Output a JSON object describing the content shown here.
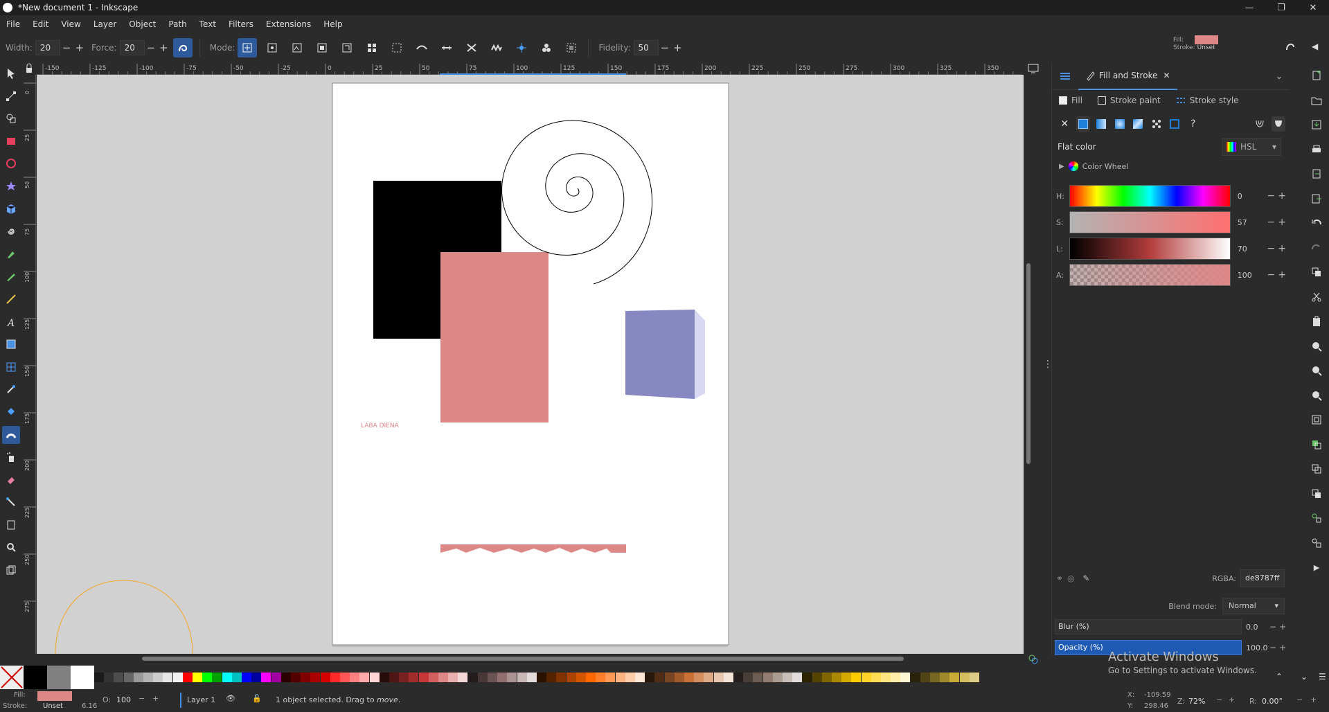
{
  "window": {
    "title": "*New document 1 - Inkscape",
    "controls": [
      "—",
      "❐",
      "✕"
    ]
  },
  "menu": [
    "File",
    "Edit",
    "View",
    "Layer",
    "Object",
    "Path",
    "Text",
    "Filters",
    "Extensions",
    "Help"
  ],
  "toolbar": {
    "width_label": "Width:",
    "width_value": "20",
    "force_label": "Force:",
    "force_value": "20",
    "mode_label": "Mode:",
    "fidelity_label": "Fidelity:",
    "fidelity_value": "50"
  },
  "fill_indicator": {
    "fill_label": "Fill:",
    "stroke_label": "Stroke:",
    "stroke_value": "Unset",
    "fill_color": "#de8787"
  },
  "ruler": {
    "top_labels": [
      "-150",
      "-125",
      "-100",
      "-75",
      "-50",
      "-25",
      "0",
      "25",
      "50",
      "75",
      "100",
      "125",
      "150",
      "175",
      "200",
      "225",
      "250",
      "275",
      "300",
      "325",
      "350"
    ],
    "left_labels": [
      "0",
      "25",
      "50",
      "75",
      "100",
      "125",
      "150",
      "175",
      "200",
      "225",
      "250",
      "275"
    ]
  },
  "canvas": {
    "text_object": "LABA DIENA"
  },
  "dialog": {
    "tab_label": "Fill and Stroke",
    "subtabs": [
      "Fill",
      "Stroke paint",
      "Stroke style"
    ],
    "flat_color_label": "Flat color",
    "color_mode": "HSL",
    "color_wheel_label": "Color Wheel",
    "sliders": [
      {
        "label": "H:",
        "value": "0"
      },
      {
        "label": "S:",
        "value": "57"
      },
      {
        "label": "L:",
        "value": "70"
      },
      {
        "label": "A:",
        "value": "100"
      }
    ],
    "rgba_label": "RGBA:",
    "rgba_value": "de8787ff",
    "blend_label": "Blend mode:",
    "blend_value": "Normal",
    "blur_label": "Blur (%)",
    "blur_value": "0.0",
    "opacity_label": "Opacity (%)",
    "opacity_value": "100.0"
  },
  "status": {
    "fill_label": "Fill:",
    "stroke_label": "Stroke:",
    "stroke_value": "Unset",
    "stroke_width": "6.16",
    "opacity_label": "O:",
    "opacity_value": "100",
    "layer": "Layer 1",
    "message_pre": "1 object selected. Drag to ",
    "message_em": "move",
    "message_post": ".",
    "x_label": "X:",
    "x_value": "-109.59",
    "y_label": "Y:",
    "y_value": "298.46",
    "zoom_label": "Z:",
    "zoom_value": "72%",
    "rot_label": "R:",
    "rot_value": "0.00°"
  },
  "watermark": {
    "line1": "Activate Windows",
    "line2": "Go to Settings to activate Windows."
  },
  "colors": {
    "accent": "#2e5a9c",
    "selected_fill": "#de8787",
    "box3d_front": "#8787c1",
    "box3d_side": "#d8d8f5"
  }
}
